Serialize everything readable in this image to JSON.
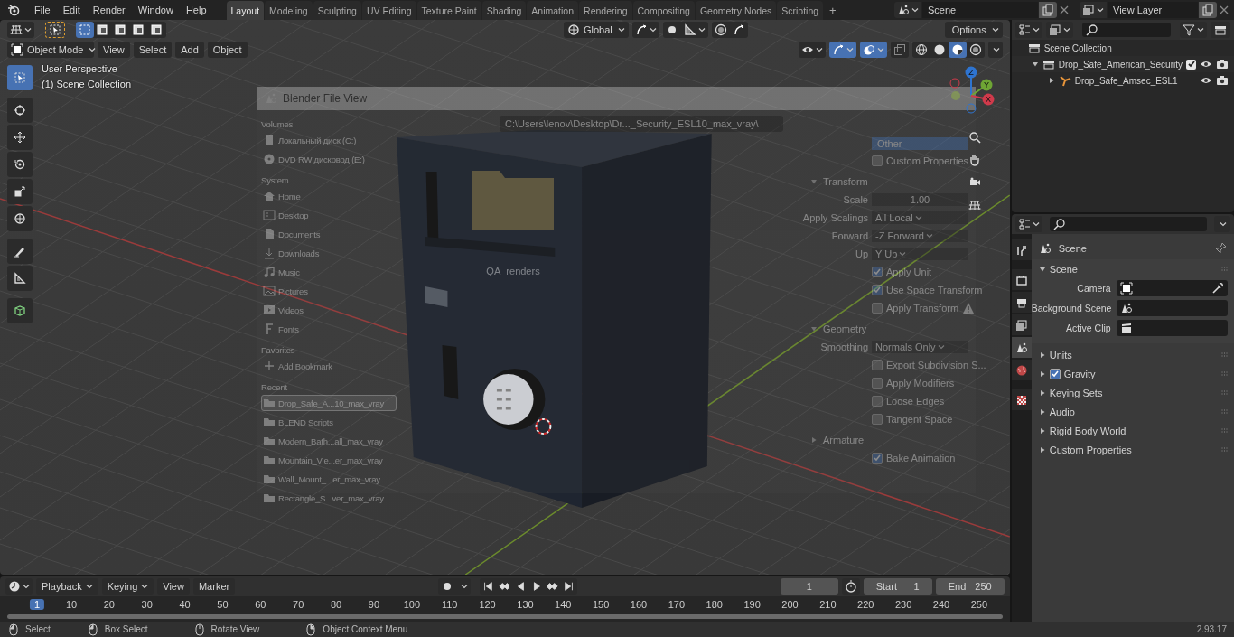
{
  "menu_bar": [
    "File",
    "Edit",
    "Render",
    "Window",
    "Help"
  ],
  "workspace_tabs": [
    {
      "label": "Layout",
      "selected": true
    },
    {
      "label": "Modeling",
      "selected": false
    },
    {
      "label": "Sculpting",
      "selected": false
    },
    {
      "label": "UV Editing",
      "selected": false
    },
    {
      "label": "Texture Paint",
      "selected": false
    },
    {
      "label": "Shading",
      "selected": false
    },
    {
      "label": "Animation",
      "selected": false
    },
    {
      "label": "Rendering",
      "selected": false
    },
    {
      "label": "Compositing",
      "selected": false
    },
    {
      "label": "Geometry Nodes",
      "selected": false
    },
    {
      "label": "Scripting",
      "selected": false
    }
  ],
  "add_workspace": "+",
  "scene": "Scene",
  "view_layer": "View Layer",
  "viewport": {
    "select_modes": [
      {
        "selected": true
      },
      {
        "selected": false
      },
      {
        "selected": false
      },
      {
        "selected": false
      },
      {
        "selected": false
      }
    ],
    "transform_orientation": "Global",
    "options": "Options",
    "mode": "Object Mode",
    "menus": [
      "View",
      "Select",
      "Add",
      "Object"
    ],
    "toggles": [
      {
        "kind": "visibility",
        "on": false
      },
      {
        "kind": "gizmo",
        "on": true
      },
      {
        "kind": "overlay",
        "on": true
      },
      {
        "kind": "xray",
        "on": false
      }
    ],
    "shading_modes": [
      {
        "kind": "wireframe",
        "selected": false
      },
      {
        "kind": "solid",
        "selected": false
      },
      {
        "kind": "material",
        "selected": true
      },
      {
        "kind": "rendered",
        "selected": false
      }
    ],
    "info": [
      "User Perspective",
      "(1) Scene Collection"
    ],
    "tools": [
      {
        "kind": "select",
        "selected": true
      },
      {
        "kind": "cursor",
        "selected": false
      },
      {
        "kind": "move",
        "selected": false
      },
      {
        "kind": "rotate",
        "selected": false
      },
      {
        "kind": "scale",
        "selected": false
      },
      {
        "kind": "transform",
        "selected": false
      },
      {
        "kind": "annotate",
        "selected": false
      },
      {
        "kind": "measure",
        "selected": false
      },
      {
        "kind": "add-cube",
        "selected": false
      }
    ],
    "gizmo_axes": [
      "Z",
      "Y",
      "X"
    ],
    "nav_buttons": [
      {
        "kind": "zoom"
      },
      {
        "kind": "hand"
      },
      {
        "kind": "camera"
      },
      {
        "kind": "grid"
      }
    ]
  },
  "file_view_overlay": {
    "title": "Blender File View",
    "sidebar": [
      {
        "title": "Volumes",
        "items": [
          {
            "kind": "drive",
            "label": "Локальный диск (C:)"
          },
          {
            "kind": "disc",
            "label": "DVD RW дисковод (E:)"
          }
        ]
      },
      {
        "title": "System",
        "items": [
          {
            "kind": "home",
            "label": "Home"
          },
          {
            "kind": "desktop",
            "label": "Desktop"
          },
          {
            "kind": "documents",
            "label": "Documents"
          },
          {
            "kind": "download",
            "label": "Downloads"
          },
          {
            "kind": "music",
            "label": "Music"
          },
          {
            "kind": "picture",
            "label": "Pictures"
          },
          {
            "kind": "video",
            "label": "Videos"
          },
          {
            "kind": "font",
            "label": "Fonts"
          }
        ]
      },
      {
        "title": "Favorites",
        "items": [
          {
            "kind": "add",
            "label": "Add Bookmark"
          }
        ]
      },
      {
        "title": "Recent",
        "items": [
          {
            "kind": "folder",
            "label": "Drop_Safe_A...10_max_vray",
            "selected": true
          },
          {
            "kind": "folder",
            "label": "BLEND Scripts",
            "selected": false
          },
          {
            "kind": "folder",
            "label": "Modern_Bath...all_max_vray",
            "selected": false
          },
          {
            "kind": "folder",
            "label": "Mountain_Vie...er_max_vray",
            "selected": false
          },
          {
            "kind": "folder",
            "label": "Wall_Mount_...er_max_vray",
            "selected": false
          },
          {
            "kind": "folder",
            "label": "Rectangle_S...ver_max_vray",
            "selected": false
          }
        ]
      }
    ],
    "path": "C:\\Users\\lenov\\Desktop\\Dr..._Security_ESL10_max_vray\\",
    "folders": [
      "QA_renders"
    ],
    "options": [
      {
        "kind": "chip",
        "label": "Other"
      },
      {
        "kind": "checkbox",
        "label": "Custom Properties",
        "checked": false
      },
      {
        "kind": "section",
        "label": "Transform",
        "expanded": true
      },
      {
        "kind": "field",
        "label": "Scale",
        "value": "1.00"
      },
      {
        "kind": "dropdown",
        "label": "Apply Scalings",
        "value": "All Local"
      },
      {
        "kind": "dropdown",
        "label": "Forward",
        "value": "-Z Forward"
      },
      {
        "kind": "dropdown",
        "label": "Up",
        "value": "Y Up"
      },
      {
        "kind": "checkbox",
        "label": "Apply Unit",
        "checked": true
      },
      {
        "kind": "checkbox",
        "label": "Use Space Transform",
        "checked": true
      },
      {
        "kind": "checkbox",
        "label": "Apply Transform",
        "checked": false,
        "warning": true
      },
      {
        "kind": "section",
        "label": "Geometry",
        "expanded": true
      },
      {
        "kind": "dropdown",
        "label": "Smoothing",
        "value": "Normals Only"
      },
      {
        "kind": "checkbox",
        "label": "Export Subdivision S...",
        "checked": false
      },
      {
        "kind": "checkbox",
        "label": "Apply Modifiers",
        "checked": false
      },
      {
        "kind": "checkbox",
        "label": "Loose Edges",
        "checked": false
      },
      {
        "kind": "checkbox",
        "label": "Tangent Space",
        "checked": false
      },
      {
        "kind": "section",
        "label": "Armature",
        "expanded": false
      },
      {
        "kind": "checkbox",
        "label": "Bake Animation",
        "checked": true
      }
    ]
  },
  "outliner": {
    "root": "Scene Collection",
    "items": [
      {
        "label": "Drop_Safe_American_Security",
        "kind": "collection",
        "expanded": true,
        "checked": true,
        "children": [
          {
            "label": "Drop_Safe_Amsec_ESL1",
            "kind": "object",
            "expanded": false
          }
        ]
      }
    ]
  },
  "properties": {
    "tabs": [
      {
        "kind": "tool",
        "selected": false
      },
      {
        "kind": "render",
        "selected": false
      },
      {
        "kind": "output",
        "selected": false
      },
      {
        "kind": "view-layer",
        "selected": false
      },
      {
        "kind": "scene",
        "selected": true
      },
      {
        "kind": "world",
        "selected": false
      },
      {
        "kind": "texture",
        "selected": false
      }
    ],
    "context": "Scene",
    "panels": [
      {
        "label": "Scene",
        "expanded": true,
        "fields": [
          {
            "label": "Camera",
            "kind": "camera"
          },
          {
            "label": "Background Scene",
            "kind": "scene"
          },
          {
            "label": "Active Clip",
            "kind": "clip"
          }
        ]
      },
      {
        "label": "Units",
        "expanded": false
      },
      {
        "label": "Gravity",
        "expanded": false,
        "checked": true
      },
      {
        "label": "Keying Sets",
        "expanded": false
      },
      {
        "label": "Audio",
        "expanded": false
      },
      {
        "label": "Rigid Body World",
        "expanded": false
      },
      {
        "label": "Custom Properties",
        "expanded": false
      }
    ]
  },
  "timeline": {
    "menus": [
      {
        "label": "Playback",
        "dropdown": true
      },
      {
        "label": "Keying",
        "dropdown": true
      },
      {
        "label": "View",
        "dropdown": false
      },
      {
        "label": "Marker",
        "dropdown": false
      }
    ],
    "current_frame": "1",
    "start_label": "Start",
    "start": "1",
    "end_label": "End",
    "end": "250",
    "ruler": [
      {
        "label": "1",
        "selected": true
      },
      {
        "label": "10",
        "selected": false
      },
      {
        "label": "20",
        "selected": false
      },
      {
        "label": "30",
        "selected": false
      },
      {
        "label": "40",
        "selected": false
      },
      {
        "label": "50",
        "selected": false
      },
      {
        "label": "60",
        "selected": false
      },
      {
        "label": "70",
        "selected": false
      },
      {
        "label": "80",
        "selected": false
      },
      {
        "label": "90",
        "selected": false
      },
      {
        "label": "100",
        "selected": false
      },
      {
        "label": "110",
        "selected": false
      },
      {
        "label": "120",
        "selected": false
      },
      {
        "label": "130",
        "selected": false
      },
      {
        "label": "140",
        "selected": false
      },
      {
        "label": "150",
        "selected": false
      },
      {
        "label": "160",
        "selected": false
      },
      {
        "label": "170",
        "selected": false
      },
      {
        "label": "180",
        "selected": false
      },
      {
        "label": "190",
        "selected": false
      },
      {
        "label": "200",
        "selected": false
      },
      {
        "label": "210",
        "selected": false
      },
      {
        "label": "220",
        "selected": false
      },
      {
        "label": "230",
        "selected": false
      },
      {
        "label": "240",
        "selected": false
      },
      {
        "label": "250",
        "selected": false
      }
    ]
  },
  "status_bar": {
    "hints": [
      {
        "kind": "left",
        "label": "Select"
      },
      {
        "kind": "left-drag",
        "label": "Box Select"
      },
      {
        "kind": "middle",
        "label": "Rotate View"
      },
      {
        "kind": "right",
        "label": "Object Context Menu"
      }
    ],
    "version": "2.93.17"
  }
}
